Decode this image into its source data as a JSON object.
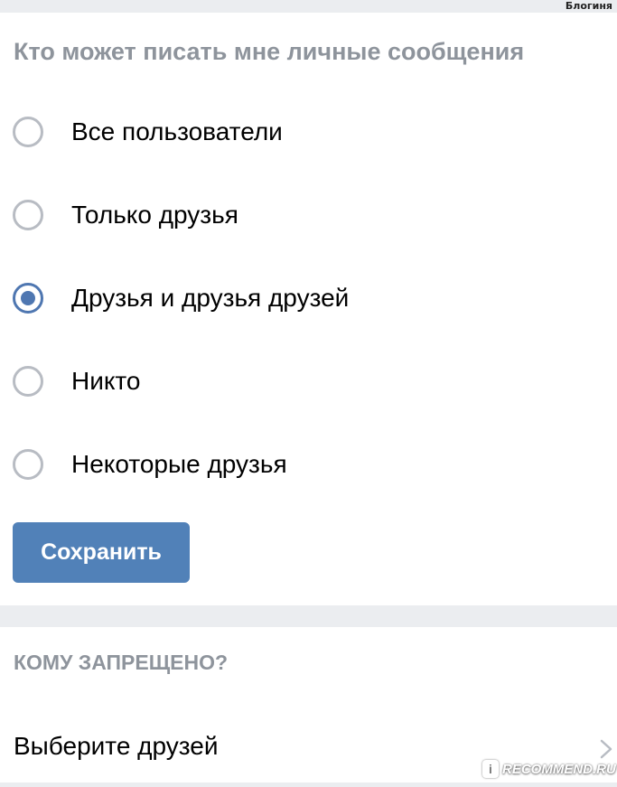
{
  "header": {
    "owner_name": "Блогиня"
  },
  "privacy": {
    "title": "Кто может писать мне личные сообщения",
    "options": [
      {
        "label": "Все пользователи",
        "selected": false
      },
      {
        "label": "Только друзья",
        "selected": false
      },
      {
        "label": "Друзья и друзья друзей",
        "selected": true
      },
      {
        "label": "Никто",
        "selected": false
      },
      {
        "label": "Некоторые друзья",
        "selected": false
      }
    ],
    "save_label": "Сохранить"
  },
  "forbidden": {
    "header": "КОМУ ЗАПРЕЩЕНО?",
    "select_friends_label": "Выберите друзей"
  },
  "watermark": {
    "text": "RECOMMEND.RU",
    "logo_glyph": "i"
  },
  "colors": {
    "accent": "#5181b8",
    "radio_checked": "#4f77b1",
    "radio_unchecked": "#b8bcc3",
    "secondary_text": "#8e949c",
    "separator": "#ebedf0"
  },
  "icons": {
    "radio": "radio-button",
    "chevron": "chevron-right-icon"
  }
}
